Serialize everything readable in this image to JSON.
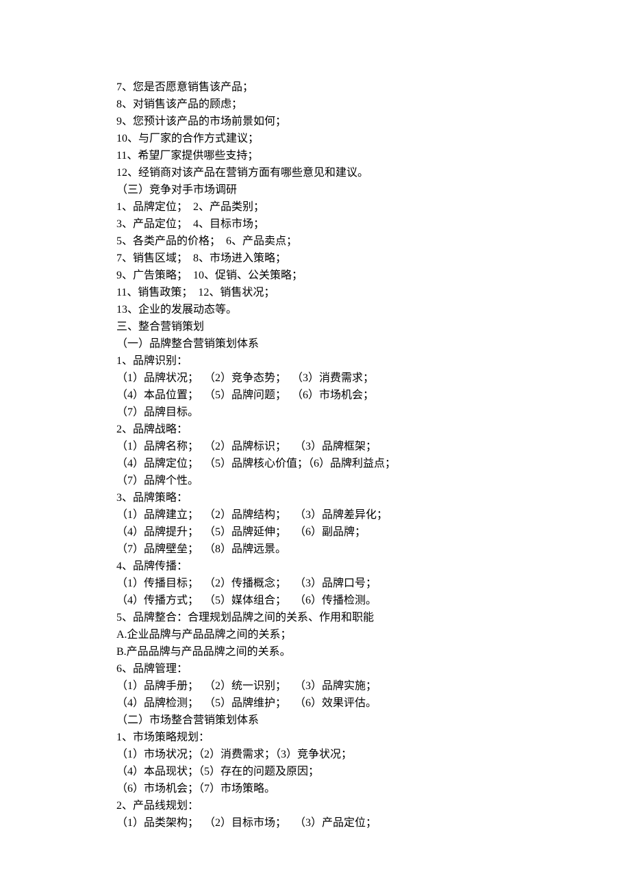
{
  "lines": [
    "7、您是否愿意销售该产品；",
    "8、对销售该产品的顾虑；",
    "9、您预计该产品的市场前景如何；",
    "10、与厂家的合作方式建议；",
    "11、希望厂家提供哪些支持；",
    "12、经销商对该产品在营销方面有哪些意见和建议。",
    "（三）竞争对手市场调研",
    "1、品牌定位；  2、产品类别；",
    "3、产品定位；  4、目标市场；",
    "5、各类产品的价格；  6、产品卖点；",
    "7、销售区域；  8、市场进入策略；",
    "9、广告策略；  10、促销、公关策略；",
    "11、销售政策；  12、销售状况；",
    "13、企业的发展动态等。",
    "三、整合营销策划",
    "（一）品牌整合营销策划体系",
    "1、品牌识别：",
    "（1）品牌状况；  （2）竞争态势；  （3）消费需求；",
    "（4）本品位置；  （5）品牌问题；  （6）市场机会；",
    "（7）品牌目标。",
    "2、品牌战略：",
    "（1）品牌名称；  （2）品牌标识；   （3）品牌框架；",
    "（4）品牌定位；  （5）品牌核心价值；（6）品牌利益点；",
    "（7）品牌个性。",
    "3、品牌策略：",
    "（1）品牌建立；  （2）品牌结构；   （3）品牌差异化；",
    "（4）品牌提升；  （5）品牌延伸；   （6）副品牌；",
    "（7）品牌壁垒；  （8）品牌远景。",
    "4、品牌传播：",
    "（1）传播目标；  （2）传播概念；   （3）品牌口号；",
    "（4）传播方式；  （5）媒体组合；   （6）传播检测。",
    "5、品牌整合：合理规划品牌之间的关系、作用和职能",
    "A.企业品牌与产品品牌之间的关系；",
    "B.产品品牌与产品品牌之间的关系。",
    "6、品牌管理：",
    "（1）品牌手册；  （2）统一识别；   （3）品牌实施；",
    "（4）品牌检测；  （5）品牌维护；   （6）效果评估。",
    "（二）市场整合营销策划体系",
    "1、市场策略规划：",
    "（1）市场状况；（2）消费需求；（3）竞争状况；",
    "（4）本品现状；（5）存在的问题及原因；",
    "（6）市场机会；（7）市场策略。",
    "2、产品线规划：",
    "（1）品类架构；  （2）目标市场；   （3）产品定位；"
  ]
}
